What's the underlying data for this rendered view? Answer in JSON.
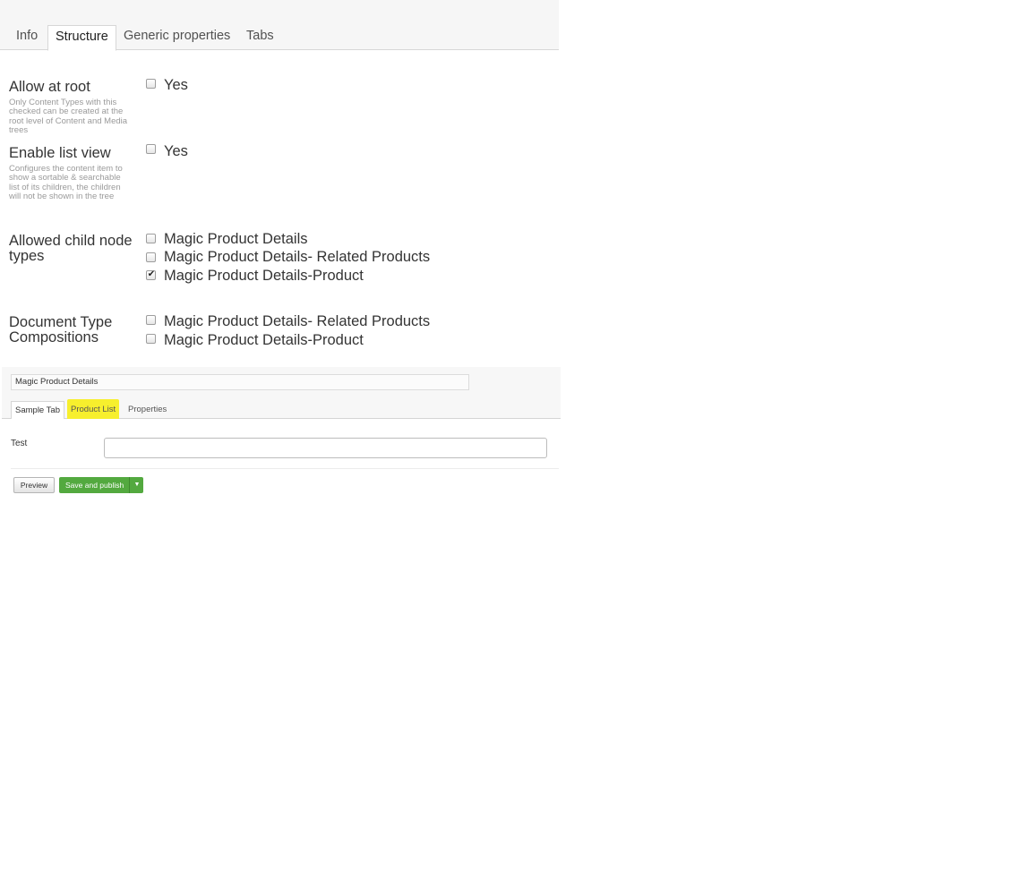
{
  "top_tabs": [
    {
      "label": "Info"
    },
    {
      "label": "Structure"
    },
    {
      "label": "Generic properties"
    },
    {
      "label": "Tabs"
    }
  ],
  "allow_at_root": {
    "label": "Allow at root",
    "description": "Only Content Types with this checked can be created at the root level of Content and Media trees",
    "option_label": "Yes",
    "checked": false
  },
  "enable_list_view": {
    "label": "Enable list view",
    "description": "Configures the content item to show a sortable & searchable list of its children, the children will not be shown in the tree",
    "option_label": "Yes",
    "checked": false
  },
  "allowed_child_node_types": {
    "label": "Allowed child node types",
    "options": [
      {
        "label": "Magic Product Details",
        "checked": false
      },
      {
        "label": "Magic Product Details- Related Products",
        "checked": false
      },
      {
        "label": "Magic Product Details-Product",
        "checked": true
      }
    ]
  },
  "compositions": {
    "label": "Document Type Compositions",
    "options": [
      {
        "label": "Magic Product Details- Related Products",
        "checked": false
      },
      {
        "label": "Magic Product Details-Product",
        "checked": false
      }
    ]
  },
  "preview": {
    "name_value": "Magic Product Details",
    "tabs": [
      {
        "label": "Sample Tab"
      },
      {
        "label": "Product List"
      },
      {
        "label": "Properties"
      }
    ],
    "highlight_color": "#f7ef2d",
    "field_label": "Test",
    "field_value": "",
    "preview_button": "Preview",
    "save_button": "Save and publish",
    "save_button_color": "#53a93f"
  }
}
